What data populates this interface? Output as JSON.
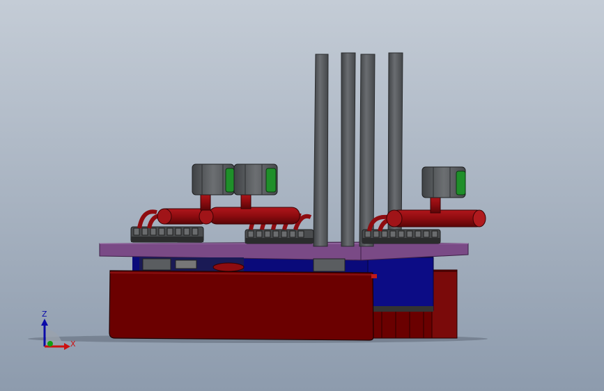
{
  "viewport": {
    "background_top": "#c4ccd6",
    "background_bottom": "#8d9bad"
  },
  "model_colors": {
    "frame_red": "#6b0000",
    "pipe_red": "#8e0c10",
    "plate_purple": "#7a4a86",
    "body_blue": "#0a0a7a",
    "column_gray": "#5c5f63",
    "motor_gray": "#5a5d60",
    "motor_green": "#1f8f2a",
    "base_dark": "#3a3a3a"
  },
  "triad": {
    "z_label": "Z",
    "x_label": "X",
    "z_color": "#0a0aa8",
    "x_color": "#cc1010",
    "y_color": "#11a011"
  }
}
